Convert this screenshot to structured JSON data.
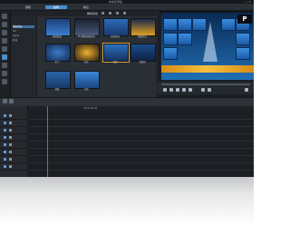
{
  "titlebar": {
    "title": "未命名專案"
  },
  "tabs": [
    {
      "id": "capture",
      "label": "擷取"
    },
    {
      "id": "edit",
      "label": "編輯"
    },
    {
      "id": "produce",
      "label": "輸出"
    }
  ],
  "library": {
    "header_title": "轉場特效",
    "folders": [
      "所有內容",
      "3D",
      "Alpha",
      "區塊"
    ],
    "thumbnails": [
      {
        "label": "動態四格"
      },
      {
        "label": "3D 翻轉旋轉拼接"
      },
      {
        "label": "搖擺拼接"
      },
      {
        "label": "跳躍拼接"
      },
      {
        "label": "粒子"
      },
      {
        "label": "快速"
      },
      {
        "label": "搖擺"
      },
      {
        "label": "百葉窗"
      },
      {
        "label": "滑動"
      },
      {
        "label": "光線"
      }
    ]
  },
  "preview": {
    "logo": "P"
  },
  "timeline": {
    "ruler_label": "00;00;00;00"
  },
  "colors": {
    "accent": "#4a8fd1",
    "playhead": "#d94b3a",
    "preview_blue": "#1f6fb5"
  }
}
